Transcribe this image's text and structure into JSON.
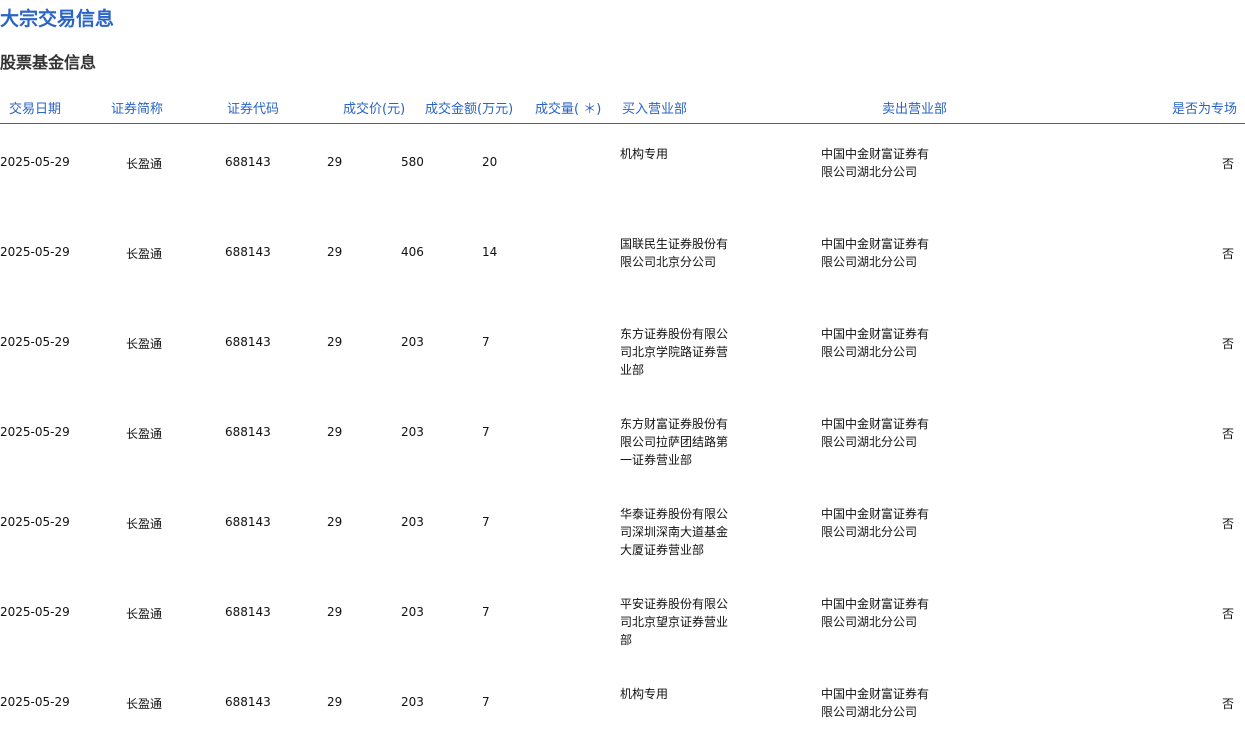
{
  "header": {
    "title": "大宗交易信息",
    "section": "股票基金信息"
  },
  "table": {
    "columns": [
      "交易日期",
      "证券简称",
      "证券代码",
      "成交价(元)",
      "成交金额(万元)",
      "成交量( ＊)",
      "买入营业部",
      "卖出营业部",
      "是否为专场"
    ],
    "rows": [
      {
        "date": "2025-05-29",
        "name": "长盈通",
        "code": "688143",
        "price": "29",
        "amount": "580",
        "volume": "20",
        "buyer": "机构专用",
        "seller": "中国中金财富证券有限公司湖北分公司",
        "special": "否"
      },
      {
        "date": "2025-05-29",
        "name": "长盈通",
        "code": "688143",
        "price": "29",
        "amount": "406",
        "volume": "14",
        "buyer": "国联民生证券股份有限公司北京分公司",
        "seller": "中国中金财富证券有限公司湖北分公司",
        "special": "否"
      },
      {
        "date": "2025-05-29",
        "name": "长盈通",
        "code": "688143",
        "price": "29",
        "amount": "203",
        "volume": "7",
        "buyer": "东方证券股份有限公司北京学院路证券营业部",
        "seller": "中国中金财富证券有限公司湖北分公司",
        "special": "否"
      },
      {
        "date": "2025-05-29",
        "name": "长盈通",
        "code": "688143",
        "price": "29",
        "amount": "203",
        "volume": "7",
        "buyer": "东方财富证券股份有限公司拉萨团结路第一证券营业部",
        "seller": "中国中金财富证券有限公司湖北分公司",
        "special": "否"
      },
      {
        "date": "2025-05-29",
        "name": "长盈通",
        "code": "688143",
        "price": "29",
        "amount": "203",
        "volume": "7",
        "buyer": "华泰证券股份有限公司深圳深南大道基金大厦证券营业部",
        "seller": "中国中金财富证券有限公司湖北分公司",
        "special": "否"
      },
      {
        "date": "2025-05-29",
        "name": "长盈通",
        "code": "688143",
        "price": "29",
        "amount": "203",
        "volume": "7",
        "buyer": "平安证券股份有限公司北京望京证券营业部",
        "seller": "中国中金财富证券有限公司湖北分公司",
        "special": "否"
      },
      {
        "date": "2025-05-29",
        "name": "长盈通",
        "code": "688143",
        "price": "29",
        "amount": "203",
        "volume": "7",
        "buyer": "机构专用",
        "seller": "中国中金财富证券有限公司湖北分公司",
        "special": "否"
      }
    ]
  }
}
